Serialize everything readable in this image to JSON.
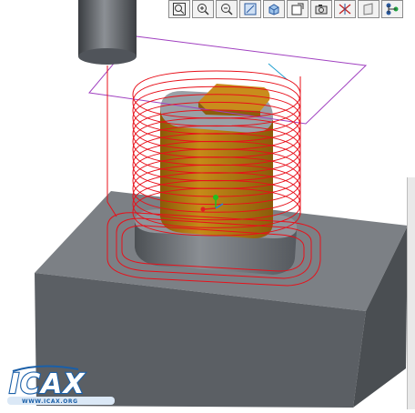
{
  "toolbar": {
    "buttons": [
      {
        "icon": "zoom-fit-icon"
      },
      {
        "icon": "zoom-in-icon"
      },
      {
        "icon": "zoom-out-icon"
      },
      {
        "icon": "sketch-view-icon"
      },
      {
        "icon": "shading-icon"
      },
      {
        "icon": "saved-views-icon"
      },
      {
        "icon": "camera-icon"
      },
      {
        "icon": "datum-display-icon"
      },
      {
        "icon": "display-style-icon"
      },
      {
        "icon": "spin-center-icon"
      }
    ]
  },
  "logo": {
    "text": "ICAX",
    "subtext": "WWW.ICAX.ORG"
  },
  "colors": {
    "toolpath": "#e8101a",
    "stock": "#6f7378",
    "part": "#b87a10",
    "tool": "#5a5e63",
    "fixture_plane": "#a040c0",
    "logo": "#1a5fa8"
  }
}
